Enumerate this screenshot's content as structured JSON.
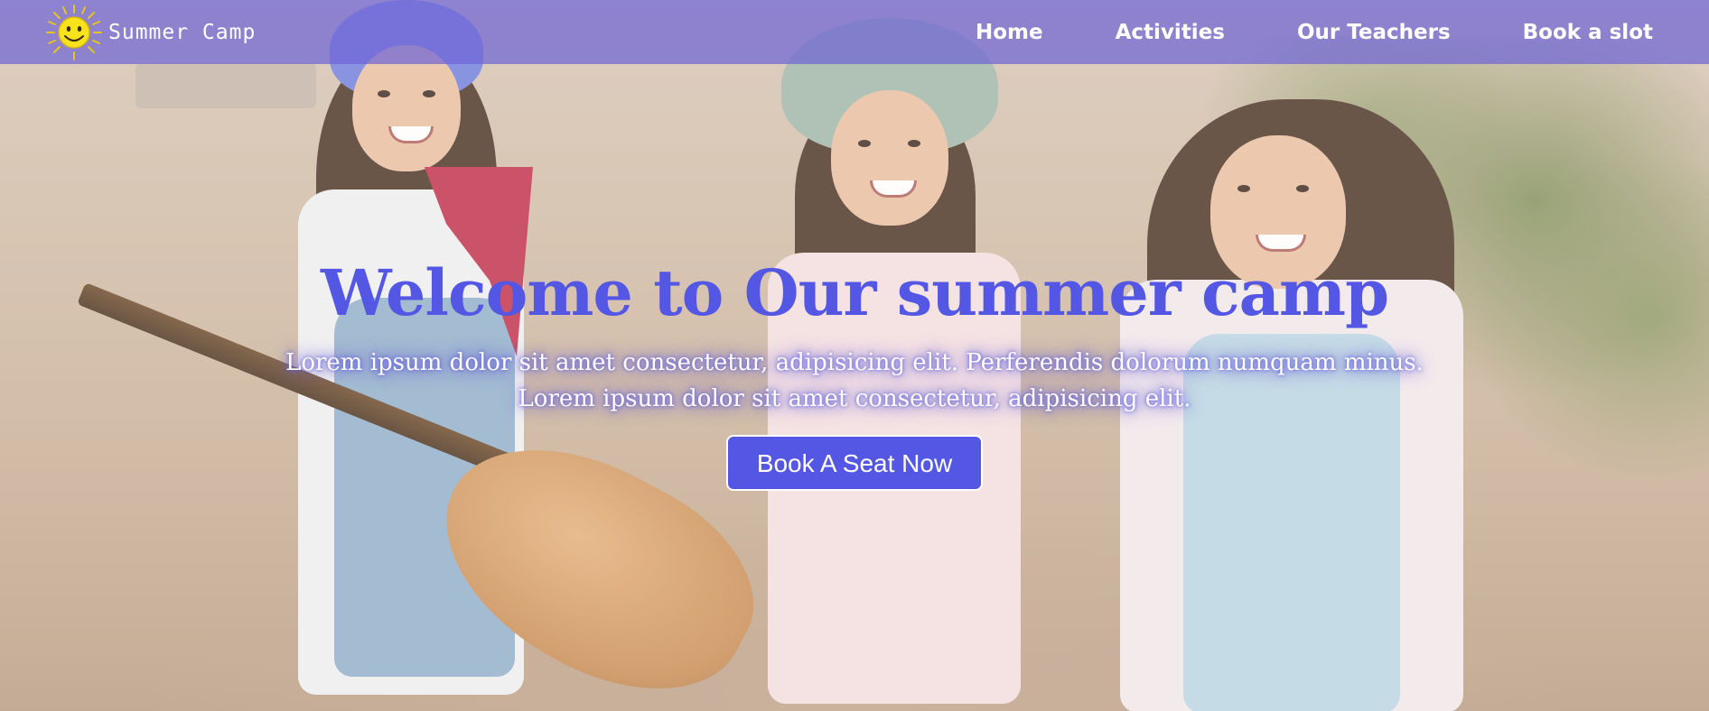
{
  "colors": {
    "navbar_bg": "#6f65d6",
    "accent": "#5457e4",
    "text_light": "#ffffff"
  },
  "brand": {
    "logo_icon": "sun-icon",
    "name": "Summer Camp"
  },
  "nav": {
    "items": [
      {
        "label": "Home"
      },
      {
        "label": "Activities"
      },
      {
        "label": "Our Teachers"
      },
      {
        "label": "Book a slot"
      }
    ]
  },
  "hero": {
    "title": "Welcome to Our summer camp",
    "subtitle_line1": "Lorem ipsum dolor sit amet consectetur, adipisicing elit. Perferendis dolorum numquam minus.",
    "subtitle_line2": "Lorem ipsum dolor sit amet consectetur, adipisicing elit.",
    "cta_label": "Book A Seat Now"
  }
}
